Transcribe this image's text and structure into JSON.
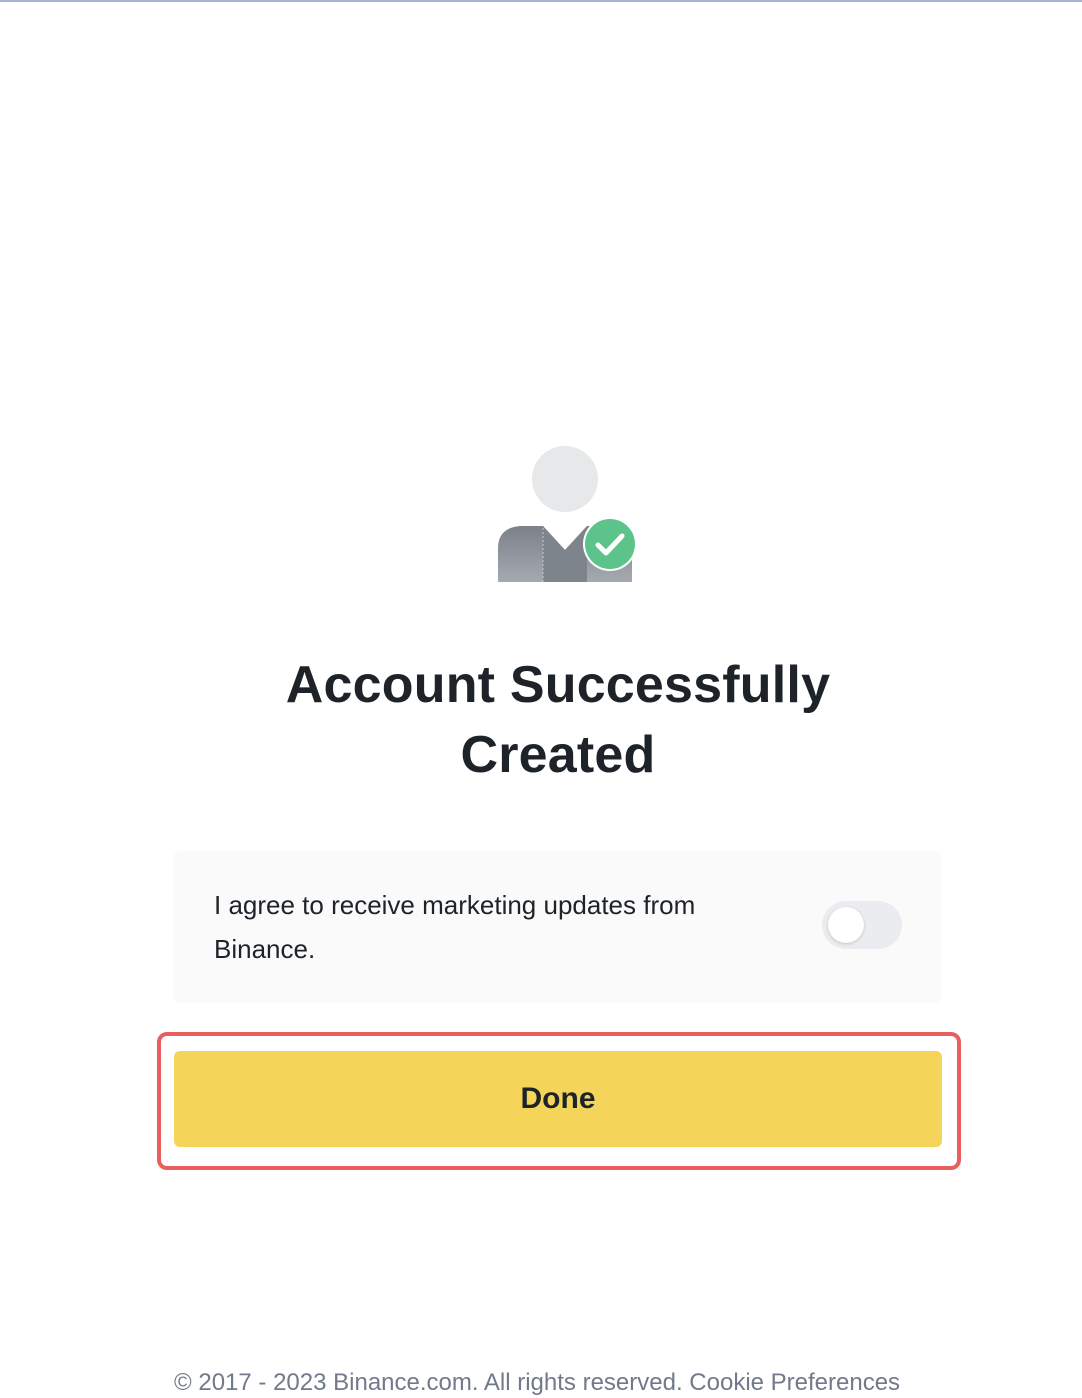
{
  "page": {
    "title_line1": "Account Successfully",
    "title_line2": "Created"
  },
  "illustration": {
    "icon": "user-account-created-icon",
    "badge_icon": "check-icon",
    "badge_color": "#5cc48a",
    "avatar_color": "#e6e8ea"
  },
  "consent": {
    "text": "I agree to receive marketing updates from Binance.",
    "toggle_on": false
  },
  "actions": {
    "done_label": "Done",
    "done_color": "#f4d55a"
  },
  "highlight": {
    "color": "#e8605d"
  },
  "footer": {
    "text": "© 2017 - 2023 Binance.com. All rights reserved.   Cookie Preferences"
  }
}
